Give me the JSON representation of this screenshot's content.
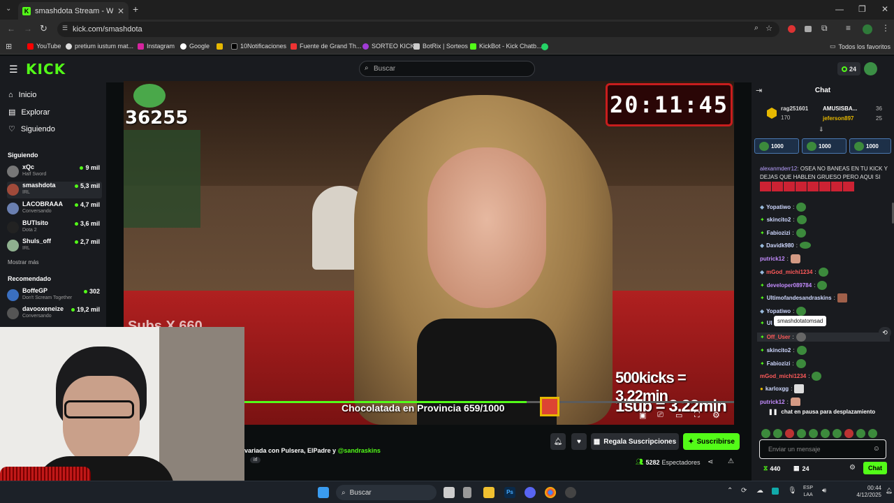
{
  "browser": {
    "tab_title": "smashdota Stream - Watch Live",
    "url": "kick.com/smashdota",
    "bookmarks": [
      "YouTube",
      "pretium iustum mat...",
      "Instagram",
      "Google",
      "10Notificaciones",
      "Fuente de Grand Th...",
      "SORTEO KICK",
      "BotRix | Sorteos",
      "KickBot - Kick Chatb..."
    ],
    "all_bookmarks": "Todos los favoritos"
  },
  "header": {
    "logo": "KICK",
    "search_placeholder": "Buscar",
    "points": "24"
  },
  "sidebar": {
    "nav": [
      {
        "label": "Inicio"
      },
      {
        "label": "Explorar"
      },
      {
        "label": "Siguiendo"
      }
    ],
    "following_title": "Siguiendo",
    "following": [
      {
        "name": "xQc",
        "category": "Half Sword",
        "viewers": "9 mil"
      },
      {
        "name": "smashdota",
        "category": "IRL",
        "viewers": "5,3 mil"
      },
      {
        "name": "LACOBRAAA",
        "category": "Conversando",
        "viewers": "4,7 mil"
      },
      {
        "name": "BUTIsito",
        "category": "Dota 2",
        "viewers": "3,6 mil"
      },
      {
        "name": "Shuls_off",
        "category": "IRL",
        "viewers": "2,7 mil"
      }
    ],
    "show_more": "Mostrar más",
    "recommended_title": "Recomendado",
    "recommended": [
      {
        "name": "BoffeGP",
        "category": "Don't Scream Together",
        "viewers": "302"
      },
      {
        "name": "davooxeneize",
        "category": "Conversando",
        "viewers": "19,2 mil"
      }
    ]
  },
  "video": {
    "counter": "36255",
    "clock": "20:11:45",
    "sub_text": "Subs X 660",
    "kicks_text": "500kicks = 3.22min",
    "sub_rate_text": "1sub = 3.22min",
    "goal_text": "Chocolatada en Provincia 659/1000"
  },
  "stream_info": {
    "title_fragment": "variada con Pulsera, ElPadre y",
    "mention": "@sandraskins",
    "tag": "irl",
    "gift_subs": "Regala Suscripciones",
    "subscribe": "Suscribirse",
    "viewers": "5282",
    "viewers_label": "Espectadores"
  },
  "chat": {
    "title": "Chat",
    "leaderboard": [
      {
        "name": "rag251601",
        "score": "170"
      },
      {
        "name": "AMUSISBA...",
        "score": "36"
      },
      {
        "name": "jeferson897",
        "score": "25"
      }
    ],
    "pinned": [
      "1000",
      "1000",
      "1000"
    ],
    "messages": [
      {
        "user": "alexanmderr12",
        "text": "OSEA NO BANEAS EN TU KICK Y DEJAS QUE HABLEN GRUESO PERO AQUI SI BANEAS",
        "color": "#b9a0ff"
      },
      {
        "user": "Yopatiwo",
        "text": "",
        "color": "#cfd8ff"
      },
      {
        "user": "skincito2",
        "text": "",
        "color": "#cfd8ff"
      },
      {
        "user": "Fabiozizi",
        "text": "",
        "color": "#cfd8ff"
      },
      {
        "user": "Davidk980",
        "text": "",
        "color": "#cfd8ff"
      },
      {
        "user": "putrick12",
        "text": "",
        "color": "#c48cff"
      },
      {
        "user": "mGod_michi1234",
        "text": "",
        "color": "#ff5a5a"
      },
      {
        "user": "developer089784",
        "text": "",
        "color": "#c48cff"
      },
      {
        "user": "Ultimofandesandraskins",
        "text": "",
        "color": "#cfd8ff"
      },
      {
        "user": "Yopatiwo",
        "text": "",
        "color": "#cfd8ff"
      },
      {
        "user": "Ul",
        "text": "",
        "color": "#cfd8ff"
      },
      {
        "user": "Off_User",
        "text": "",
        "color": "#ff5a5a"
      },
      {
        "user": "skincito2",
        "text": "",
        "color": "#cfd8ff"
      },
      {
        "user": "Fabiozizi",
        "text": "",
        "color": "#cfd8ff"
      },
      {
        "user": "mGod_michi1234",
        "text": "",
        "color": "#ff5a5a"
      },
      {
        "user": "karloxgg",
        "text": "",
        "color": "#cfd8ff"
      },
      {
        "user": "putrick12",
        "text": "",
        "color": "#c48cff"
      }
    ],
    "tooltip": "smashdotatomsad",
    "paused": "chat en pausa para desplazamiento",
    "input_placeholder": "Enviar un mensaje",
    "points": "440",
    "gift_count": "24",
    "send": "Chat"
  },
  "taskbar": {
    "search": "Buscar",
    "lang": "ESP",
    "lang2": "LAA",
    "time": "00:44",
    "date": "4/12/2025"
  }
}
